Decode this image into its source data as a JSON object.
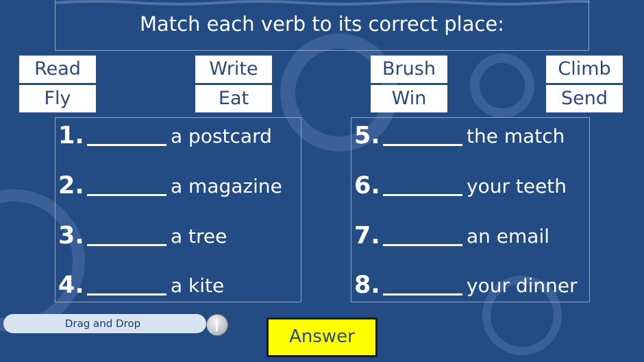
{
  "instruction": "Match each verb to its correct place:",
  "verbs": [
    "Read",
    "Write",
    "Brush",
    "Climb",
    "Fly",
    "Eat",
    "Win",
    "Send"
  ],
  "left_items": [
    {
      "number": "1.",
      "phrase": "a postcard"
    },
    {
      "number": "2.",
      "phrase": "a magazine"
    },
    {
      "number": "3.",
      "phrase": "a tree"
    },
    {
      "number": "4.",
      "phrase": "a kite"
    }
  ],
  "right_items": [
    {
      "number": "5.",
      "phrase": "the match"
    },
    {
      "number": "6.",
      "phrase": "your teeth"
    },
    {
      "number": "7.",
      "phrase": "an email"
    },
    {
      "number": "8.",
      "phrase": "your dinner"
    }
  ],
  "mode_label": "Drag and Drop",
  "answer_label": "Answer",
  "colors": {
    "background": "#234b84",
    "answer_button": "#ffff00",
    "verb_text": "#2b4a78"
  }
}
